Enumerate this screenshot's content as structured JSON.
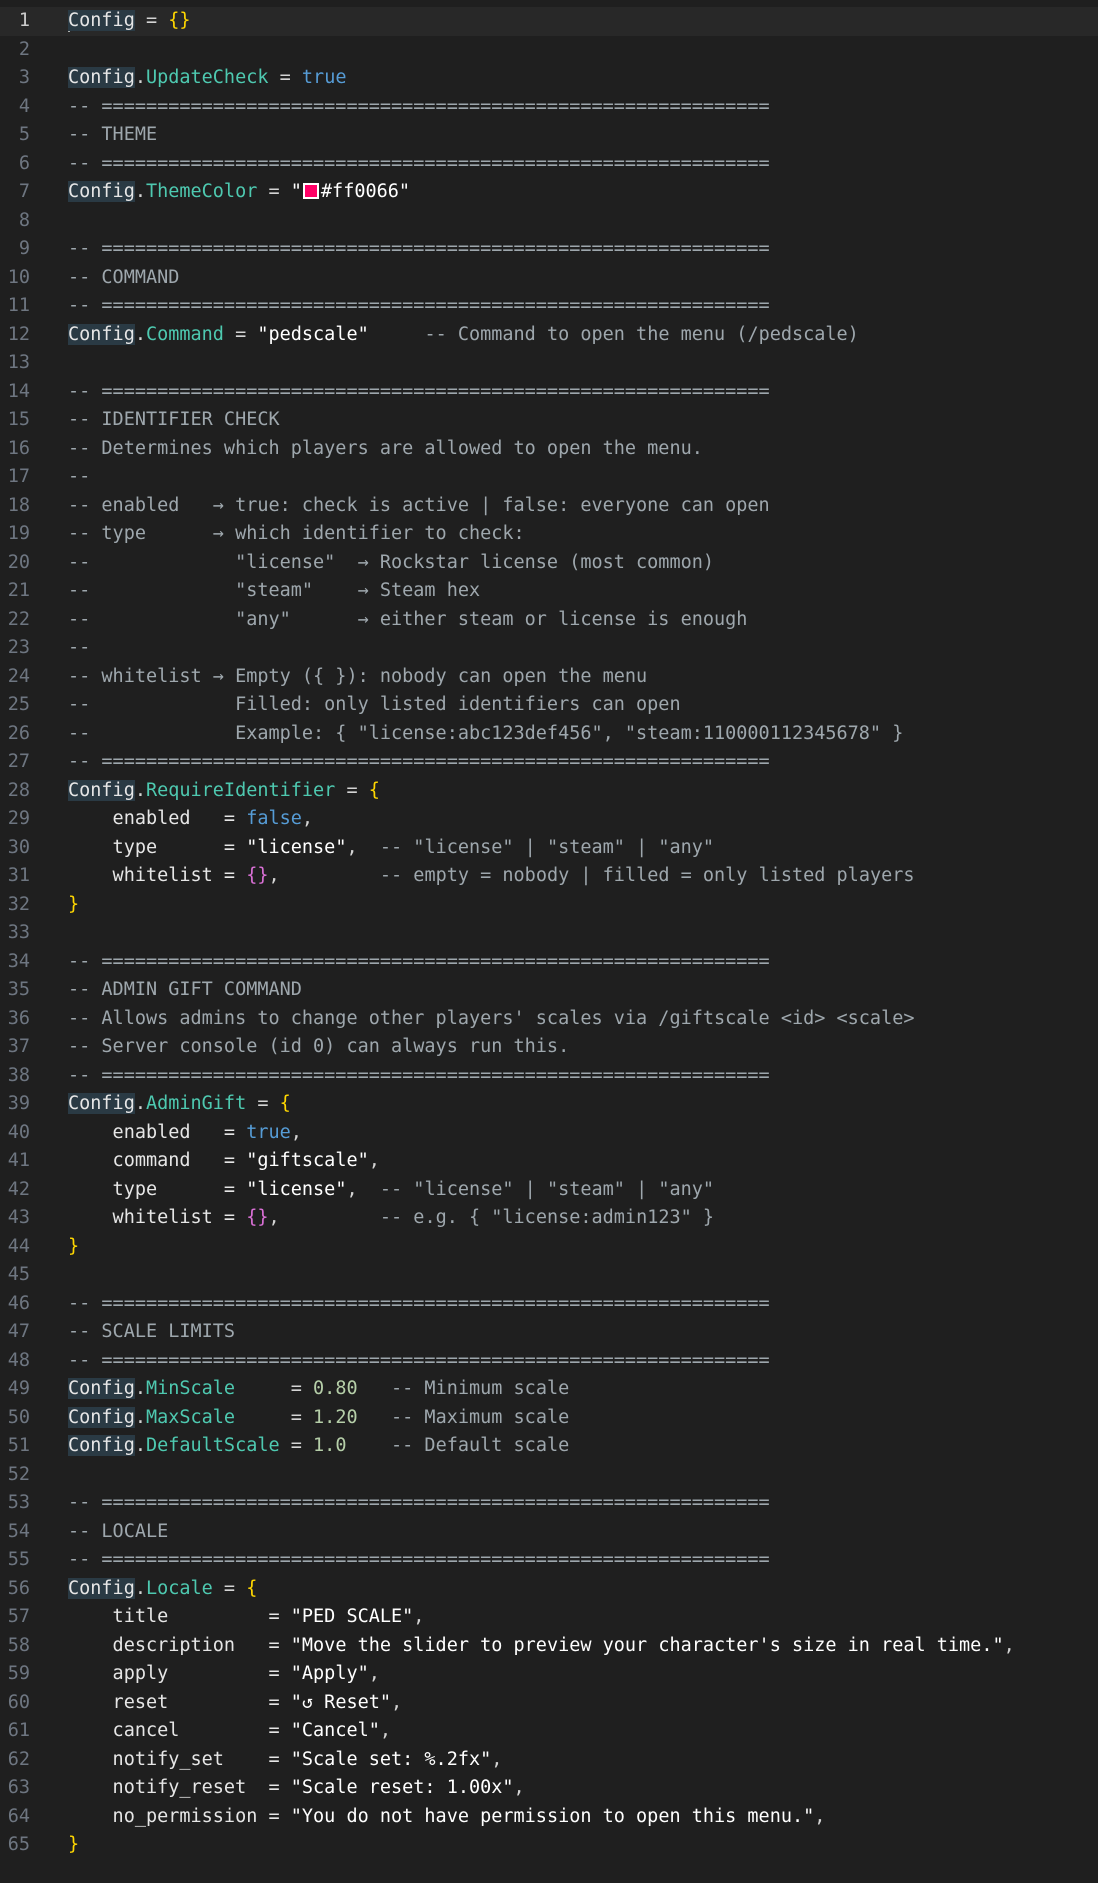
{
  "editor": {
    "active_line": 1,
    "theme_swatch_color": "#ff0066",
    "lines": [
      [
        {
          "t": "Config",
          "c": "t-ident hl",
          "cursor": true
        },
        {
          "t": " = ",
          "c": "t-op"
        },
        {
          "t": "{}",
          "c": "t-brace"
        }
      ],
      [],
      [
        {
          "t": "Config",
          "c": "t-ident hl"
        },
        {
          "t": ".",
          "c": "t-op"
        },
        {
          "t": "UpdateCheck",
          "c": "t-field"
        },
        {
          "t": " = ",
          "c": "t-op"
        },
        {
          "t": "true",
          "c": "t-bool"
        }
      ],
      [
        {
          "t": "-- ============================================================",
          "c": "t-comment"
        }
      ],
      [
        {
          "t": "-- THEME",
          "c": "t-comment"
        }
      ],
      [
        {
          "t": "-- ============================================================",
          "c": "t-comment"
        }
      ],
      [
        {
          "t": "Config",
          "c": "t-ident hl"
        },
        {
          "t": ".",
          "c": "t-op"
        },
        {
          "t": "ThemeColor",
          "c": "t-field"
        },
        {
          "t": " = ",
          "c": "t-op"
        },
        {
          "t": "\"",
          "c": "t-str"
        },
        {
          "swatch": true
        },
        {
          "t": "#ff0066\"",
          "c": "t-str"
        }
      ],
      [],
      [
        {
          "t": "-- ============================================================",
          "c": "t-comment"
        }
      ],
      [
        {
          "t": "-- COMMAND",
          "c": "t-comment"
        }
      ],
      [
        {
          "t": "-- ============================================================",
          "c": "t-comment"
        }
      ],
      [
        {
          "t": "Config",
          "c": "t-ident hl"
        },
        {
          "t": ".",
          "c": "t-op"
        },
        {
          "t": "Command",
          "c": "t-field"
        },
        {
          "t": " = ",
          "c": "t-op"
        },
        {
          "t": "\"pedscale\"",
          "c": "t-str"
        },
        {
          "t": "     -- Command to open the menu (/pedscale)",
          "c": "t-comment"
        }
      ],
      [],
      [
        {
          "t": "-- ============================================================",
          "c": "t-comment"
        }
      ],
      [
        {
          "t": "-- IDENTIFIER CHECK",
          "c": "t-comment"
        }
      ],
      [
        {
          "t": "-- Determines which players are allowed to open the menu.",
          "c": "t-comment"
        }
      ],
      [
        {
          "t": "--",
          "c": "t-comment"
        }
      ],
      [
        {
          "t": "-- enabled   → true: check is active | false: everyone can open",
          "c": "t-comment"
        }
      ],
      [
        {
          "t": "-- type      → which identifier to check:",
          "c": "t-comment"
        }
      ],
      [
        {
          "t": "--             \"license\"  → Rockstar license (most common)",
          "c": "t-comment"
        }
      ],
      [
        {
          "t": "--             \"steam\"    → Steam hex",
          "c": "t-comment"
        }
      ],
      [
        {
          "t": "--             \"any\"      → either steam or license is enough",
          "c": "t-comment"
        }
      ],
      [
        {
          "t": "--",
          "c": "t-comment"
        }
      ],
      [
        {
          "t": "-- whitelist → Empty ({ }): nobody can open the menu",
          "c": "t-comment"
        }
      ],
      [
        {
          "t": "--             Filled: only listed identifiers can open",
          "c": "t-comment"
        }
      ],
      [
        {
          "t": "--             Example: { \"license:abc123def456\", \"steam:110000112345678\" }",
          "c": "t-comment"
        }
      ],
      [
        {
          "t": "-- ============================================================",
          "c": "t-comment"
        }
      ],
      [
        {
          "t": "Config",
          "c": "t-ident hl"
        },
        {
          "t": ".",
          "c": "t-op"
        },
        {
          "t": "RequireIdentifier",
          "c": "t-field"
        },
        {
          "t": " = ",
          "c": "t-op"
        },
        {
          "t": "{",
          "c": "t-brace"
        }
      ],
      [
        {
          "t": "    enabled   = ",
          "c": "t-key"
        },
        {
          "t": "false",
          "c": "t-bool"
        },
        {
          "t": ",",
          "c": "t-op"
        }
      ],
      [
        {
          "t": "    type      = ",
          "c": "t-key"
        },
        {
          "t": "\"license\"",
          "c": "t-str"
        },
        {
          "t": ",  ",
          "c": "t-op"
        },
        {
          "t": "-- \"license\" | \"steam\" | \"any\"",
          "c": "t-comment"
        }
      ],
      [
        {
          "t": "    whitelist = ",
          "c": "t-key"
        },
        {
          "t": "{}",
          "c": "t-brace2"
        },
        {
          "t": ",         ",
          "c": "t-op"
        },
        {
          "t": "-- empty = nobody | filled = only listed players",
          "c": "t-comment"
        }
      ],
      [
        {
          "t": "}",
          "c": "t-brace"
        }
      ],
      [],
      [
        {
          "t": "-- ============================================================",
          "c": "t-comment"
        }
      ],
      [
        {
          "t": "-- ADMIN GIFT COMMAND",
          "c": "t-comment"
        }
      ],
      [
        {
          "t": "-- Allows admins to change other players' scales via /giftscale <id> <scale>",
          "c": "t-comment"
        }
      ],
      [
        {
          "t": "-- Server console (id 0) can always run this.",
          "c": "t-comment"
        }
      ],
      [
        {
          "t": "-- ============================================================",
          "c": "t-comment"
        }
      ],
      [
        {
          "t": "Config",
          "c": "t-ident hl"
        },
        {
          "t": ".",
          "c": "t-op"
        },
        {
          "t": "AdminGift",
          "c": "t-field"
        },
        {
          "t": " = ",
          "c": "t-op"
        },
        {
          "t": "{",
          "c": "t-brace"
        }
      ],
      [
        {
          "t": "    enabled   = ",
          "c": "t-key"
        },
        {
          "t": "true",
          "c": "t-bool"
        },
        {
          "t": ",",
          "c": "t-op"
        }
      ],
      [
        {
          "t": "    command   = ",
          "c": "t-key"
        },
        {
          "t": "\"giftscale\"",
          "c": "t-str"
        },
        {
          "t": ",",
          "c": "t-op"
        }
      ],
      [
        {
          "t": "    type      = ",
          "c": "t-key"
        },
        {
          "t": "\"license\"",
          "c": "t-str"
        },
        {
          "t": ",  ",
          "c": "t-op"
        },
        {
          "t": "-- \"license\" | \"steam\" | \"any\"",
          "c": "t-comment"
        }
      ],
      [
        {
          "t": "    whitelist = ",
          "c": "t-key"
        },
        {
          "t": "{}",
          "c": "t-brace2"
        },
        {
          "t": ",         ",
          "c": "t-op"
        },
        {
          "t": "-- e.g. { \"license:admin123\" }",
          "c": "t-comment"
        }
      ],
      [
        {
          "t": "}",
          "c": "t-brace"
        }
      ],
      [],
      [
        {
          "t": "-- ============================================================",
          "c": "t-comment"
        }
      ],
      [
        {
          "t": "-- SCALE LIMITS",
          "c": "t-comment"
        }
      ],
      [
        {
          "t": "-- ============================================================",
          "c": "t-comment"
        }
      ],
      [
        {
          "t": "Config",
          "c": "t-ident hl"
        },
        {
          "t": ".",
          "c": "t-op"
        },
        {
          "t": "MinScale",
          "c": "t-field"
        },
        {
          "t": "     = ",
          "c": "t-op"
        },
        {
          "t": "0.80",
          "c": "t-num"
        },
        {
          "t": "   -- Minimum scale",
          "c": "t-comment"
        }
      ],
      [
        {
          "t": "Config",
          "c": "t-ident hl"
        },
        {
          "t": ".",
          "c": "t-op"
        },
        {
          "t": "MaxScale",
          "c": "t-field"
        },
        {
          "t": "     = ",
          "c": "t-op"
        },
        {
          "t": "1.20",
          "c": "t-num"
        },
        {
          "t": "   -- Maximum scale",
          "c": "t-comment"
        }
      ],
      [
        {
          "t": "Config",
          "c": "t-ident hl"
        },
        {
          "t": ".",
          "c": "t-op"
        },
        {
          "t": "DefaultScale",
          "c": "t-field"
        },
        {
          "t": " = ",
          "c": "t-op"
        },
        {
          "t": "1.0",
          "c": "t-num"
        },
        {
          "t": "    -- Default scale",
          "c": "t-comment"
        }
      ],
      [],
      [
        {
          "t": "-- ============================================================",
          "c": "t-comment"
        }
      ],
      [
        {
          "t": "-- LOCALE",
          "c": "t-comment"
        }
      ],
      [
        {
          "t": "-- ============================================================",
          "c": "t-comment"
        }
      ],
      [
        {
          "t": "Config",
          "c": "t-ident hl"
        },
        {
          "t": ".",
          "c": "t-op"
        },
        {
          "t": "Locale",
          "c": "t-field"
        },
        {
          "t": " = ",
          "c": "t-op"
        },
        {
          "t": "{",
          "c": "t-brace"
        }
      ],
      [
        {
          "t": "    title         = ",
          "c": "t-key"
        },
        {
          "t": "\"PED SCALE\"",
          "c": "t-str"
        },
        {
          "t": ",",
          "c": "t-op"
        }
      ],
      [
        {
          "t": "    description   = ",
          "c": "t-key"
        },
        {
          "t": "\"Move the slider to preview your character's size in real time.\"",
          "c": "t-str"
        },
        {
          "t": ",",
          "c": "t-op"
        }
      ],
      [
        {
          "t": "    apply         = ",
          "c": "t-key"
        },
        {
          "t": "\"Apply\"",
          "c": "t-str"
        },
        {
          "t": ",",
          "c": "t-op"
        }
      ],
      [
        {
          "t": "    reset         = ",
          "c": "t-key"
        },
        {
          "t": "\"↺ Reset\"",
          "c": "t-str"
        },
        {
          "t": ",",
          "c": "t-op"
        }
      ],
      [
        {
          "t": "    cancel        = ",
          "c": "t-key"
        },
        {
          "t": "\"Cancel\"",
          "c": "t-str"
        },
        {
          "t": ",",
          "c": "t-op"
        }
      ],
      [
        {
          "t": "    notify_set    = ",
          "c": "t-key"
        },
        {
          "t": "\"Scale set: %.2fx\"",
          "c": "t-str"
        },
        {
          "t": ",",
          "c": "t-op"
        }
      ],
      [
        {
          "t": "    notify_reset  = ",
          "c": "t-key"
        },
        {
          "t": "\"Scale reset: 1.00x\"",
          "c": "t-str"
        },
        {
          "t": ",",
          "c": "t-op"
        }
      ],
      [
        {
          "t": "    no_permission = ",
          "c": "t-key"
        },
        {
          "t": "\"You do not have permission to open this menu.\"",
          "c": "t-str"
        },
        {
          "t": ",",
          "c": "t-op"
        }
      ],
      [
        {
          "t": "}",
          "c": "t-brace"
        }
      ]
    ]
  }
}
